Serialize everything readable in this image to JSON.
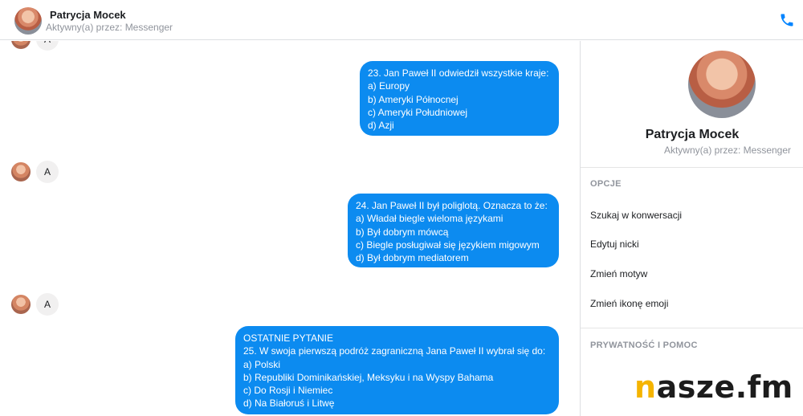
{
  "header": {
    "contact_name": "Patrycja Mocek",
    "status": "Aktywny(a) przez: Messenger",
    "call_icon": "phone-icon"
  },
  "chat": {
    "reactions": [
      {
        "text": "A"
      },
      {
        "text": "A"
      },
      {
        "text": "A"
      }
    ],
    "messages": [
      {
        "lines": [
          "23. Jan Paweł II odwiedził wszystkie kraje:",
          "a) Europy",
          "b) Ameryki Północnej",
          "c) Ameryki Południowej",
          "d) Azji"
        ]
      },
      {
        "lines": [
          "24. Jan Paweł II był poliglotą. Oznacza to że:",
          "a) Władał biegle wieloma językami",
          "b) Był dobrym mówcą",
          "c) Biegle posługiwał się językiem migowym",
          "d) Był dobrym mediatorem"
        ]
      },
      {
        "lines": [
          "OSTATNIE PYTANIE",
          "25. W swoja pierwszą podróż zagraniczną Jana Paweł II wybrał się do:",
          "a) Polski",
          "b) Republiki Dominikańskiej, Meksyku i na Wyspy Bahama",
          "c) Do Rosji i Niemiec",
          "d) Na Białoruś i Litwę"
        ]
      }
    ],
    "bubble_color": "#0c8bf0"
  },
  "panel": {
    "name": "Patrycja Mocek",
    "status": "Aktywny(a) przez: Messenger",
    "options_title": "OPCJE",
    "options": [
      "Szukaj w konwersacji",
      "Edytuj nicki",
      "Zmień motyw",
      "Zmień ikonę emoji"
    ],
    "privacy_title": "PRYWATNOŚĆ I POMOC"
  },
  "watermark": {
    "first": "n",
    "rest": "asze.fm",
    "accent": "#f5b400"
  }
}
